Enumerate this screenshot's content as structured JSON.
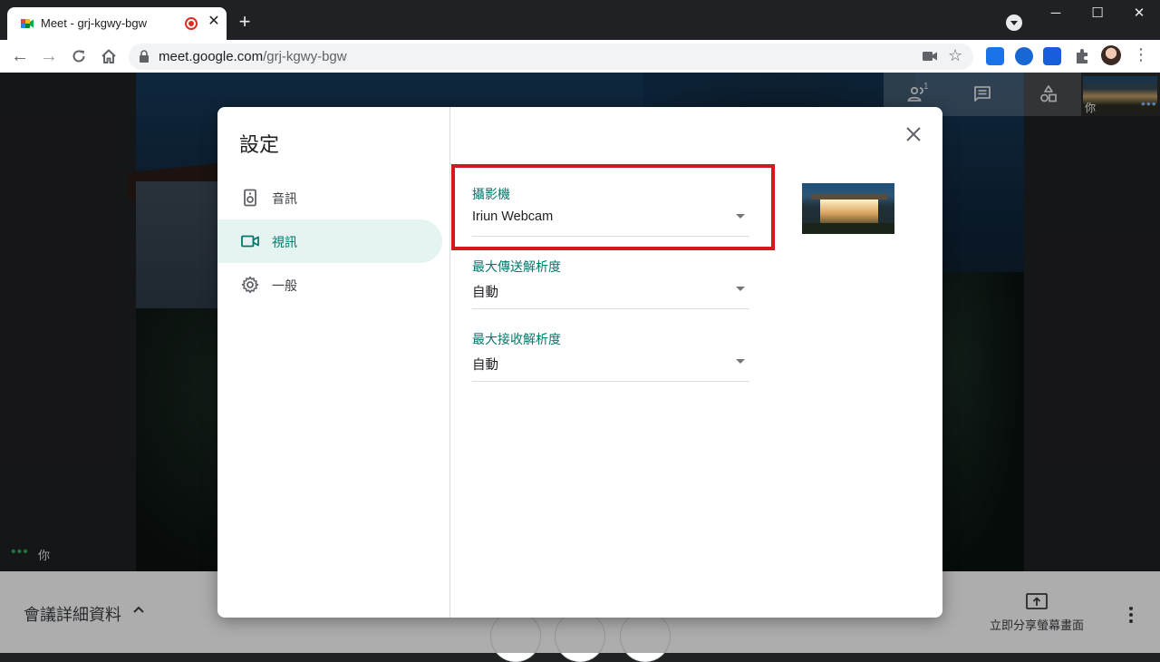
{
  "browser": {
    "tab_title": "Meet - grj-kgwy-bgw",
    "tab_close": "✕",
    "new_tab": "+",
    "url_host": "meet.google.com",
    "url_path": "/grj-kgwy-bgw",
    "window_controls": {
      "minimize": "─",
      "maximize": "☐",
      "close": "✕"
    }
  },
  "meet": {
    "participants_badge": "1",
    "self_tile_label": "你",
    "self_label": "你",
    "meeting_details": "會議詳細資料",
    "present_now": "立即分享螢幕畫面"
  },
  "dialog": {
    "title": "設定",
    "nav": [
      {
        "label": "音訊",
        "icon": "speaker-icon"
      },
      {
        "label": "視訊",
        "icon": "videocam-icon"
      },
      {
        "label": "一般",
        "icon": "gear-icon"
      }
    ],
    "active_nav": "視訊",
    "fields": [
      {
        "label": "攝影機",
        "value": "Iriun Webcam"
      },
      {
        "label": "最大傳送解析度",
        "value": "自動"
      },
      {
        "label": "最大接收解析度",
        "value": "自動"
      }
    ]
  },
  "colors": {
    "accent": "#00796b",
    "active_nav_bg": "#e6f4f1",
    "highlight": "#d7151d",
    "record": "#d93025"
  }
}
